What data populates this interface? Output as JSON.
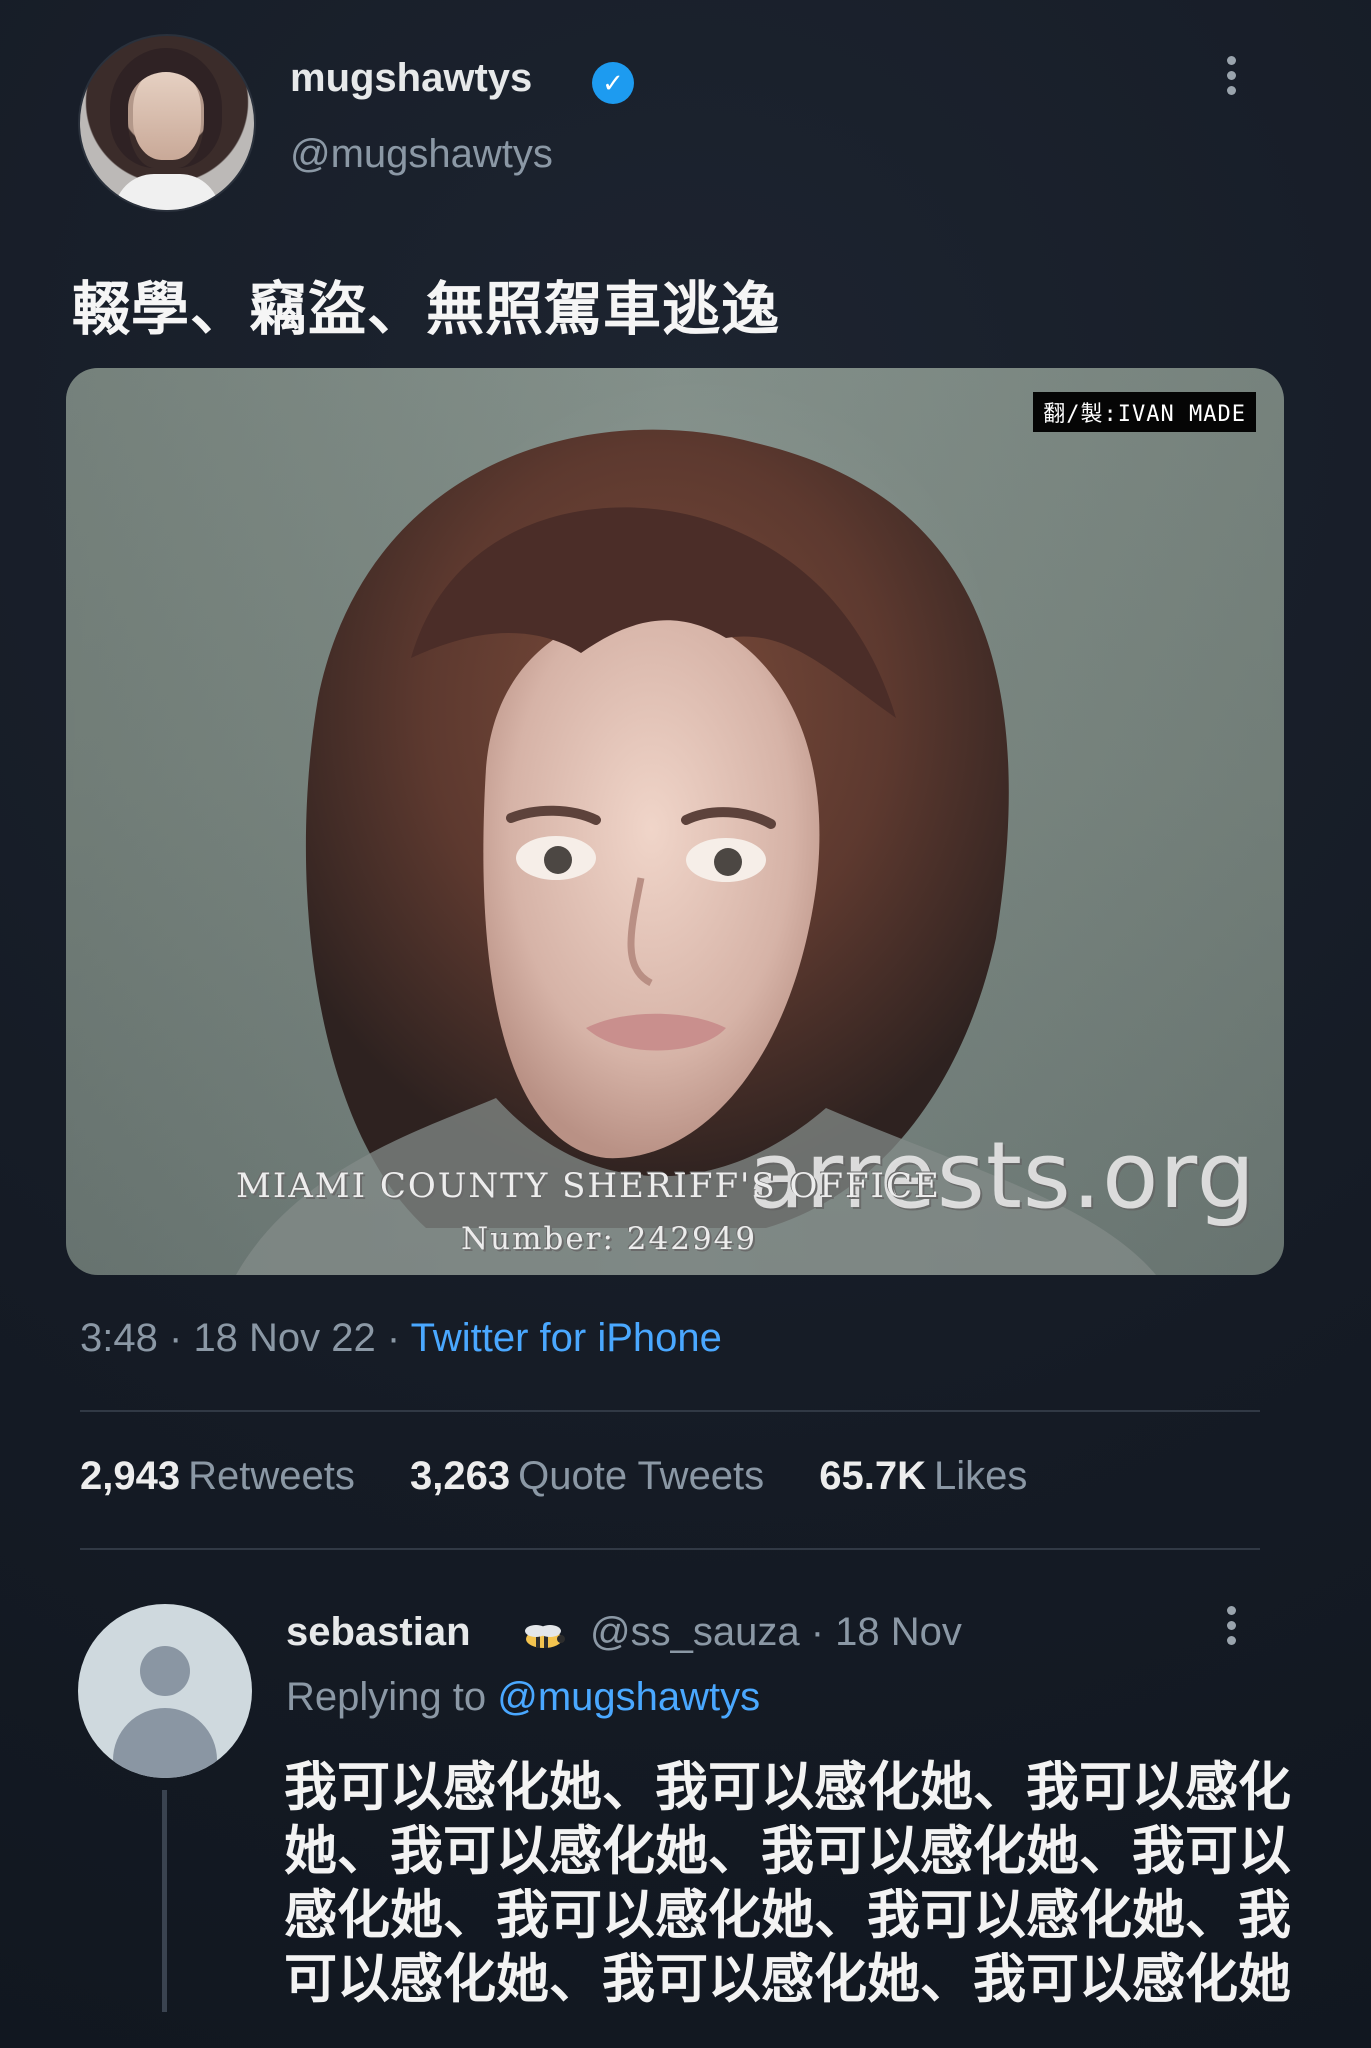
{
  "tweet": {
    "author": {
      "name": "mugshawtys",
      "handle": "@mugshawtys",
      "verified": true
    },
    "text": "輟學、竊盜、無照駕車逃逸",
    "media": {
      "translator_tag": "翻/製:IVAN MADE",
      "office_text": "MIAMI COUNTY SHERIFF'S OFFICE",
      "number_text": "Number: 242949",
      "site_watermark": "arrests.org"
    },
    "meta": {
      "time": "3:48",
      "date": "18 Nov 22",
      "separator": "·",
      "source": "Twitter for iPhone"
    },
    "stats": {
      "retweets_count": "2,943",
      "retweets_label": "Retweets",
      "quotes_count": "3,263",
      "quotes_label": "Quote Tweets",
      "likes_count": "65.7K",
      "likes_label": "Likes"
    }
  },
  "reply": {
    "name": "sebastian",
    "handle_date": "@ss_sauza · 18 Nov",
    "replying_prefix": "Replying to",
    "replying_target": "@mugshawtys",
    "text": "我可以感化她、我可以感化她、我可以感化她、我可以感化她、我可以感化她、我可以感化她、我可以感化她、我可以感化她、我可以感化她、我可以感化她、我可以感化她"
  },
  "icons": {
    "verified": "verified-badge-icon",
    "more": "more-options-icon",
    "bee": "bee-emoji-icon"
  },
  "colors": {
    "background": "#151b25",
    "accent": "#1d9bf0",
    "link": "#4aa8ff",
    "muted": "#8b98a5"
  }
}
